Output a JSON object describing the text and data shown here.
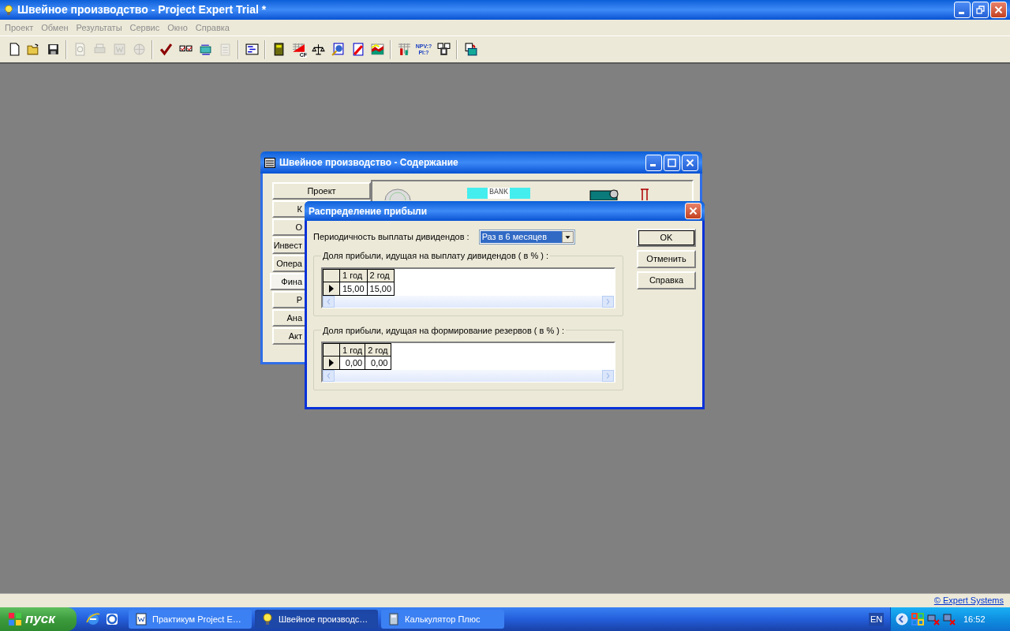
{
  "window": {
    "title": "Швейное производство - Project Expert Trial *"
  },
  "menu": [
    {
      "label": "Проект",
      "disabled": true
    },
    {
      "label": "Обмен",
      "disabled": true
    },
    {
      "label": "Результаты",
      "disabled": true
    },
    {
      "label": "Сервис",
      "disabled": true
    },
    {
      "label": "Окно",
      "disabled": true
    },
    {
      "label": "Справка",
      "disabled": true
    }
  ],
  "toolbar": [
    [
      {
        "disabled": false
      },
      {
        "disabled": false
      },
      {
        "disabled": false
      }
    ],
    [
      {
        "disabled": true
      },
      {
        "disabled": true
      },
      {
        "disabled": true
      },
      {
        "disabled": true
      }
    ],
    [
      {
        "disabled": false
      },
      {
        "disabled": false
      },
      {
        "disabled": false
      },
      {
        "disabled": true
      }
    ],
    [
      {
        "disabled": false
      }
    ],
    [
      {
        "disabled": false
      },
      {
        "disabled": false,
        "text": "CF"
      },
      {
        "disabled": false
      },
      {
        "disabled": false
      },
      {
        "disabled": false
      },
      {
        "disabled": false
      }
    ],
    [
      {
        "disabled": false
      },
      {
        "disabled": false,
        "lines": [
          "NPV:?",
          "PI:?"
        ]
      },
      {
        "disabled": false
      }
    ],
    [
      {
        "disabled": false
      }
    ]
  ],
  "child_window": {
    "title": "Швейное производство - Содержание",
    "sections": [
      {
        "label": "Проект",
        "selected": false
      },
      {
        "label": "К",
        "selected": false
      },
      {
        "label": "О",
        "selected": false
      },
      {
        "label": "Инвест",
        "selected": false
      },
      {
        "label": "Опера",
        "selected": false
      },
      {
        "label": "Фина",
        "selected": true
      },
      {
        "label": "Р",
        "selected": false
      },
      {
        "label": "Ана",
        "selected": false
      },
      {
        "label": "Акт",
        "selected": false
      }
    ],
    "bank_sign": "BANK"
  },
  "dialog": {
    "title": "Распределение прибыли",
    "period": {
      "label": "Периодичность выплаты дивидендов :",
      "value": "Раз в 6 месяцев"
    },
    "groups": [
      {
        "legend": "Доля прибыли, идущая на выплату дивидендов ( в % ) :",
        "columns": [
          "1 год",
          "2 год"
        ],
        "values": [
          "15,00",
          "15,00"
        ]
      },
      {
        "legend": "Доля прибыли, идущая на формирование резервов ( в % ) :",
        "columns": [
          "1 год",
          "2 год"
        ],
        "values": [
          "0,00",
          "0,00"
        ]
      }
    ],
    "buttons": [
      {
        "label": "OK",
        "default": true
      },
      {
        "label": "Отменить",
        "default": false
      },
      {
        "label": "Справка",
        "default": false
      }
    ]
  },
  "status_bar": {
    "link": "© Expert Systems"
  },
  "taskbar": {
    "start": "пуск",
    "tasks": [
      {
        "label": "Практикум Project E…",
        "selected": false,
        "kind": "document"
      },
      {
        "label": "Швейное производс…",
        "selected": true,
        "kind": "bulb"
      },
      {
        "label": "Калькулятор Плюс",
        "selected": false,
        "kind": "calculator"
      }
    ],
    "language": "EN",
    "clock": "16:52"
  }
}
